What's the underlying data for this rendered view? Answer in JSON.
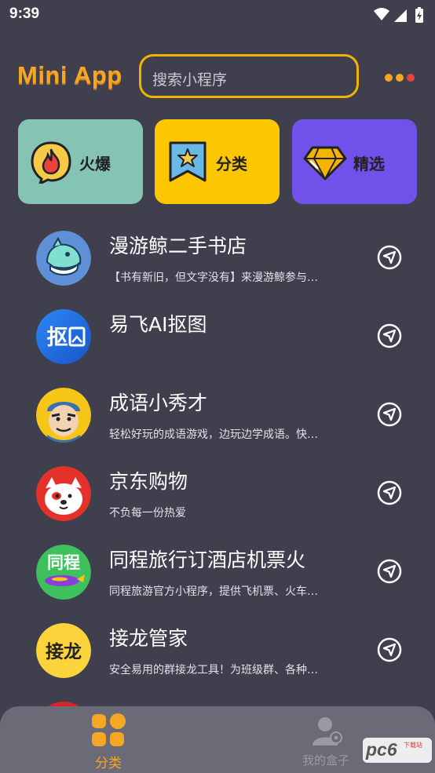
{
  "status_bar": {
    "time": "9:39"
  },
  "header": {
    "logo": "Mini App",
    "search_placeholder": "搜索小程序"
  },
  "categories": [
    {
      "label": "火爆",
      "icon": "fire-icon",
      "bg": "#85c3b5"
    },
    {
      "label": "分类",
      "icon": "bookmark-star-icon",
      "bg": "#fcc600"
    },
    {
      "label": "精选",
      "icon": "gem-icon",
      "bg": "#7052ea"
    }
  ],
  "mini_programs": [
    {
      "title": "漫游鲸二手书店",
      "desc": "【书有新旧，但文字没有】来漫游鲸参与…"
    },
    {
      "title": "易飞AI抠图",
      "desc": ""
    },
    {
      "title": "成语小秀才",
      "desc": "轻松好玩的成语游戏，边玩边学成语。快…"
    },
    {
      "title": "京东购物",
      "desc": "不负每一份热爱"
    },
    {
      "title": "同程旅行订酒店机票火",
      "desc": "同程旅游官方小程序，提供飞机票、火车…"
    },
    {
      "title": "接龙管家",
      "desc": "安全易用的群接龙工具！为班级群、各种…"
    }
  ],
  "avatar_text": {
    "yifei": "抠",
    "tongcheng": "同程",
    "jielong": "接龙"
  },
  "tabs": [
    {
      "label": "分类",
      "active": true
    },
    {
      "label": "我的盒子",
      "active": false
    }
  ],
  "watermark": {
    "text": "pc6",
    "sub": "下载站"
  },
  "colors": {
    "accent": "#f5a623",
    "active_tab": "#f5a623",
    "inactive_tab": "#9a9aa5"
  }
}
